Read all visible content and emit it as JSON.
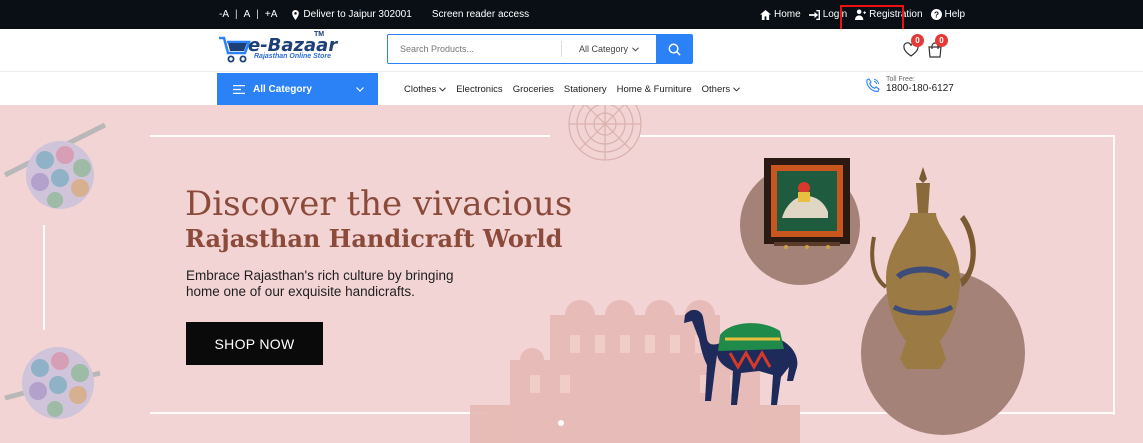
{
  "topbar": {
    "font_small": "-A",
    "font_normal": "A",
    "font_large": "+A",
    "deliver": "Deliver to Jaipur 302001",
    "screen_reader": "Screen reader access",
    "home": "Home",
    "login": "Login",
    "registration": "Registration",
    "help": "Help"
  },
  "header": {
    "logo_text": "e-Bazaar",
    "logo_tm": "TM",
    "logo_tagline": "Rajasthan Online Store",
    "search_placeholder": "Search Products...",
    "category_select": "All Category",
    "wishlist_count": "0",
    "cart_count": "0"
  },
  "nav": {
    "all_category": "All Category",
    "items": [
      {
        "label": "Clothes",
        "has_dropdown": true
      },
      {
        "label": "Electronics",
        "has_dropdown": false
      },
      {
        "label": "Groceries",
        "has_dropdown": false
      },
      {
        "label": "Stationery",
        "has_dropdown": false
      },
      {
        "label": "Home & Furniture",
        "has_dropdown": false
      },
      {
        "label": "Others",
        "has_dropdown": true
      }
    ],
    "toll_label": "Toll Free:",
    "toll_number": "1800-180-6127"
  },
  "banner": {
    "heading_line1": "Discover the vivacious",
    "heading_line2": "Rajasthan Handicraft World",
    "description": "Embrace Rajasthan's rich culture by bringing home one of our exquisite handicrafts.",
    "button": "SHOP NOW"
  },
  "colors": {
    "topbar_bg": "#0a0f16",
    "accent_blue": "#2b82f6",
    "banner_bg": "#f2d4d4",
    "heading": "#8b4a3a",
    "badge": "#e53935",
    "highlight_box": "#ee1111"
  }
}
